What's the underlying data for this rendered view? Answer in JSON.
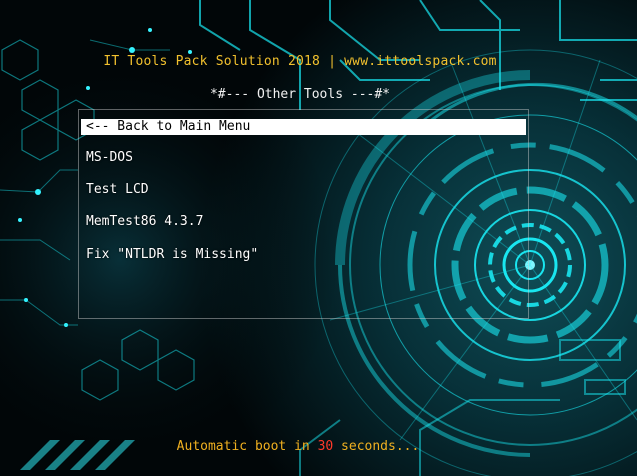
{
  "header": {
    "title": "IT Tools Pack Solution 2018 | www.ittoolspack.com"
  },
  "menu": {
    "title": "*#--- Other Tools ---#*",
    "items": [
      {
        "label": "<-- Back to Main Menu",
        "selected": true
      },
      {
        "label": "MS-DOS",
        "selected": false
      },
      {
        "label": "Test LCD",
        "selected": false
      },
      {
        "label": "MemTest86 4.3.7",
        "selected": false
      },
      {
        "label": "Fix \"NTLDR is Missing\"",
        "selected": false
      }
    ]
  },
  "footer": {
    "prefix": "Automatic boot in ",
    "seconds": "30",
    "suffix": " seconds..."
  },
  "colors": {
    "title": "#f2c12e",
    "footer": "#f0b020",
    "countdown": "#ff3a2a",
    "background_glow": "#19e6f0",
    "selection_bg": "#ffffff"
  }
}
